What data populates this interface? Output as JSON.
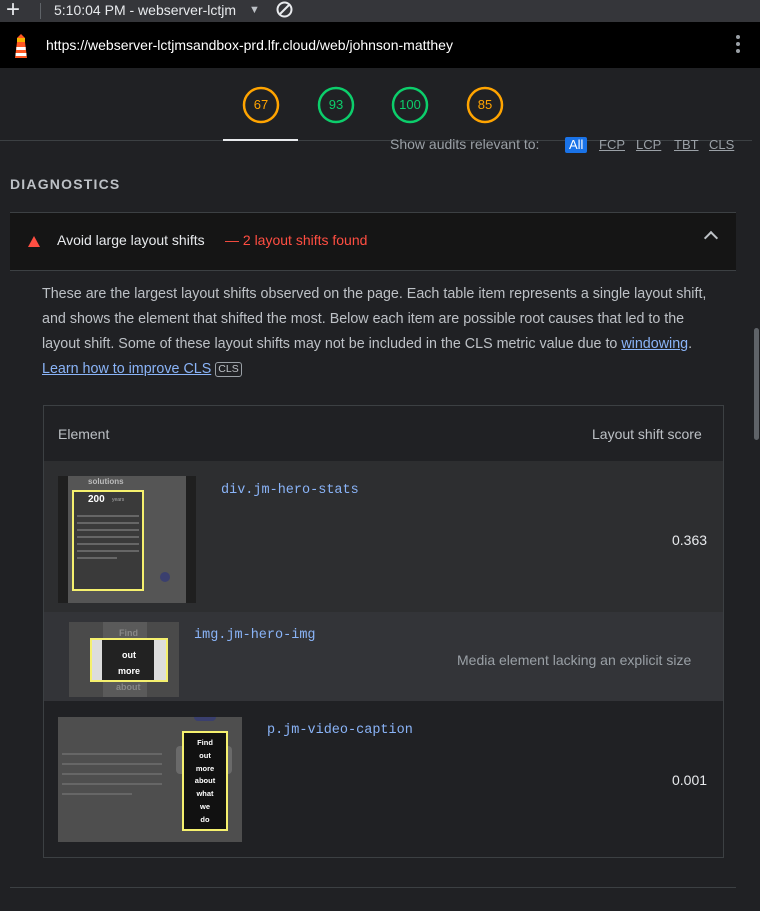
{
  "browser": {
    "tab_title": "5:10:04 PM - webserver-lctjm",
    "url": "https://webserver-lctjmsandbox-prd.lfr.cloud/web/johnson-matthey"
  },
  "gauges": [
    {
      "value": "67",
      "color": "#ffa400"
    },
    {
      "value": "93",
      "color": "#0cce6b"
    },
    {
      "value": "100",
      "color": "#0cce6b"
    },
    {
      "value": "85",
      "color": "#ffa400"
    }
  ],
  "filter": {
    "label": "Show audits relevant to:",
    "options": [
      "All",
      "FCP",
      "LCP",
      "TBT",
      "CLS"
    ]
  },
  "section_title": "DIAGNOSTICS",
  "audit": {
    "title": "Avoid large layout shifts",
    "display_value": "— 2 layout shifts found",
    "description": "These are the largest layout shifts observed on the page. Each table item represents a single layout shift, and shows the element that shifted the most. Below each item are possible root causes that led to the layout shift. Some of these layout shifts may not be included in the CLS metric value due to",
    "link_windowing": "windowing",
    "link_learn": "Learn how to improve CLS",
    "badge": "CLS"
  },
  "table": {
    "col_element": "Element",
    "col_score": "Layout shift score",
    "rows": [
      {
        "selector": "div.jm-hero-stats",
        "score": "0.363",
        "thumb_text": {
          "heading": "solutions",
          "big": "200",
          "small": "years"
        }
      },
      {
        "selector": "img.jm-hero-img",
        "reason": "Media element lacking an explicit size",
        "thumb_text": {
          "lines": [
            "Find",
            "out",
            "more",
            "about"
          ]
        }
      },
      {
        "selector": "p.jm-video-caption",
        "score": "0.001",
        "thumb_text": {
          "lines": [
            "Find",
            "out",
            "more",
            "about",
            "what",
            "we",
            "do"
          ]
        }
      }
    ]
  }
}
